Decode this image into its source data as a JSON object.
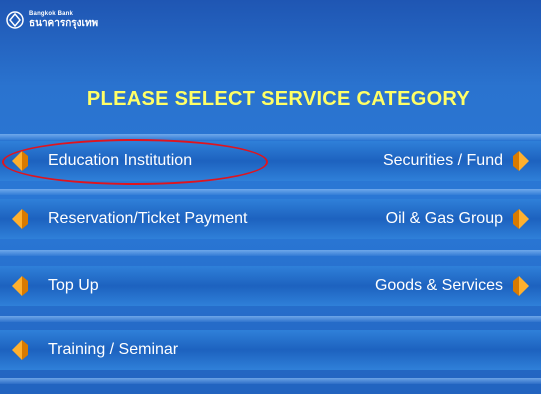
{
  "logo": {
    "name_en": "Bangkok Bank",
    "name_th": "ธนาคารกรุงเทพ"
  },
  "title": "PLEASE SELECT SERVICE CATEGORY",
  "left_options": [
    "Education Institution",
    "Reservation/Ticket  Payment",
    "Top Up",
    "Training / Seminar"
  ],
  "right_options": [
    "Securities / Fund",
    "Oil & Gas Group",
    "Goods & Services"
  ],
  "colors": {
    "background": "#2a73cf",
    "title": "#ffff66",
    "highlight": "#e0141e",
    "arrow": "#ff9a00"
  }
}
